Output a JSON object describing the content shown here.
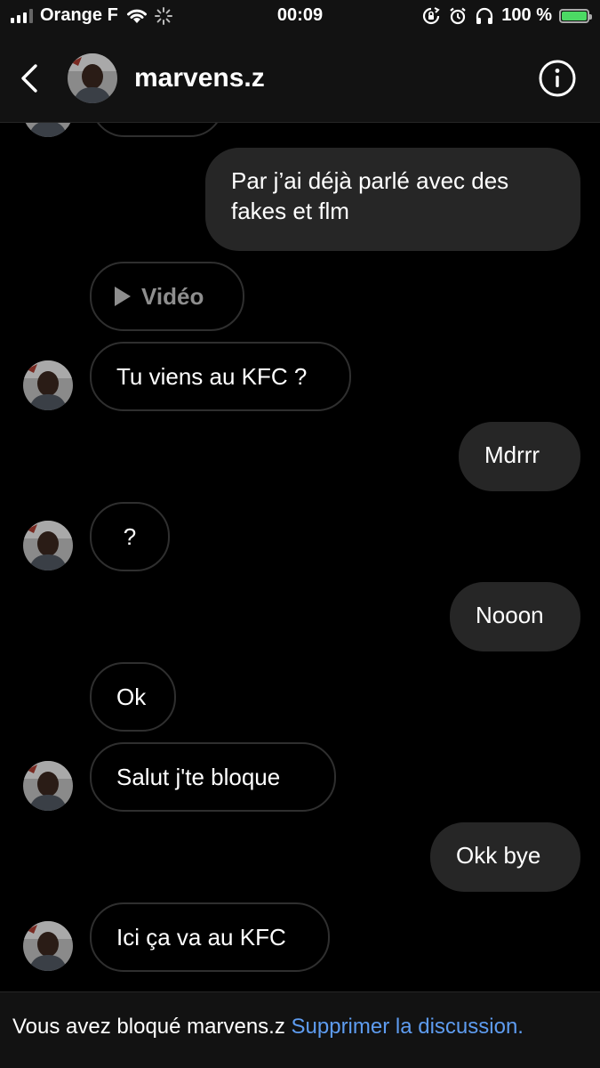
{
  "status_bar": {
    "carrier": "Orange F",
    "time": "00:09",
    "battery": "100 %"
  },
  "header": {
    "username": "marvens.z",
    "icons": [
      "back-chevron-icon",
      "avatar",
      "info-icon"
    ]
  },
  "messages": [
    {
      "id": "m1",
      "side": "out",
      "text": "Par j’ai déjà parlé avec des fakes et flm"
    },
    {
      "id": "m2",
      "side": "in",
      "type": "video",
      "text": "Vidéo"
    },
    {
      "id": "m3",
      "side": "in",
      "text": "Tu viens au KFC ?"
    },
    {
      "id": "m4",
      "side": "out",
      "text": "Mdrrr"
    },
    {
      "id": "m5",
      "side": "in",
      "text": "?"
    },
    {
      "id": "m6",
      "side": "out",
      "text": "Nooon"
    },
    {
      "id": "m7",
      "side": "in",
      "text": "Ok"
    },
    {
      "id": "m8",
      "side": "in",
      "text": "Salut j'te bloque"
    },
    {
      "id": "m9",
      "side": "out",
      "text": "Okk bye"
    },
    {
      "id": "m10",
      "side": "in",
      "text": "Ici ça va au KFC"
    }
  ],
  "footer": {
    "text": "Vous avez bloqué marvens.z",
    "link": "Supprimer la discussion."
  },
  "colors": {
    "background": "#000000",
    "bar": "#121212",
    "outgoing_bubble": "#262626",
    "incoming_border": "#2f2f2f",
    "link": "#5e9cf0"
  }
}
